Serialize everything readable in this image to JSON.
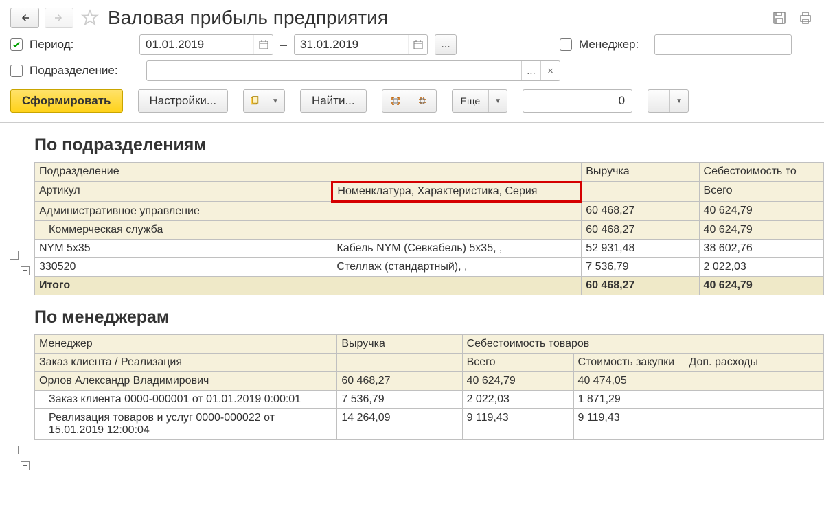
{
  "title": "Валовая прибыль предприятия",
  "period": {
    "label": "Период:",
    "checked": true,
    "from": "01.01.2019",
    "to": "31.01.2019"
  },
  "manager": {
    "label": "Менеджер:",
    "checked": false,
    "value": ""
  },
  "division": {
    "label": "Подразделение:",
    "checked": false,
    "value": ""
  },
  "toolbar": {
    "generate": "Сформировать",
    "settings": "Настройки...",
    "find": "Найти...",
    "more": "Еще",
    "num": "0"
  },
  "section1": {
    "title": "По подразделениям",
    "col_division": "Подразделение",
    "col_revenue": "Выручка",
    "col_cost": "Себестоимость то",
    "col_article": "Артикул",
    "col_nomenclature": "Номенклатура, Характеристика, Серия",
    "col_total": "Всего",
    "rows": [
      {
        "name": "Административное управление",
        "revenue": "60 468,27",
        "cost": "40 624,79"
      },
      {
        "name": "Коммерческая служба",
        "revenue": "60 468,27",
        "cost": "40 624,79"
      }
    ],
    "items": [
      {
        "article": "NYM 5x35",
        "nomen": "Кабель NYM (Севкабель) 5x35, ,",
        "revenue": "52 931,48",
        "cost": "38 602,76"
      },
      {
        "article": "330520",
        "nomen": "Стеллаж (стандартный), ,",
        "revenue": "7 536,79",
        "cost": "2 022,03"
      }
    ],
    "total_label": "Итого",
    "total_revenue": "60 468,27",
    "total_cost": "40 624,79"
  },
  "section2": {
    "title": "По менеджерам",
    "col_manager": "Менеджер",
    "col_revenue": "Выручка",
    "col_cost": "Себестоимость товаров",
    "col_order": "Заказ клиента / Реализация",
    "col_total": "Всего",
    "col_purchase": "Стоимость закупки",
    "col_add": "Доп. расходы",
    "rows": [
      {
        "name": "Орлов Александр Владимирович",
        "revenue": "60 468,27",
        "total": "40 624,79",
        "purchase": "40 474,05"
      },
      {
        "name": "Заказ клиента 0000-000001 от 01.01.2019 0:00:01",
        "revenue": "7 536,79",
        "total": "2 022,03",
        "purchase": "1 871,29"
      },
      {
        "name": "Реализация товаров и услуг 0000-000022 от 15.01.2019 12:00:04",
        "revenue": "14 264,09",
        "total": "9 119,43",
        "purchase": "9 119,43"
      }
    ]
  }
}
